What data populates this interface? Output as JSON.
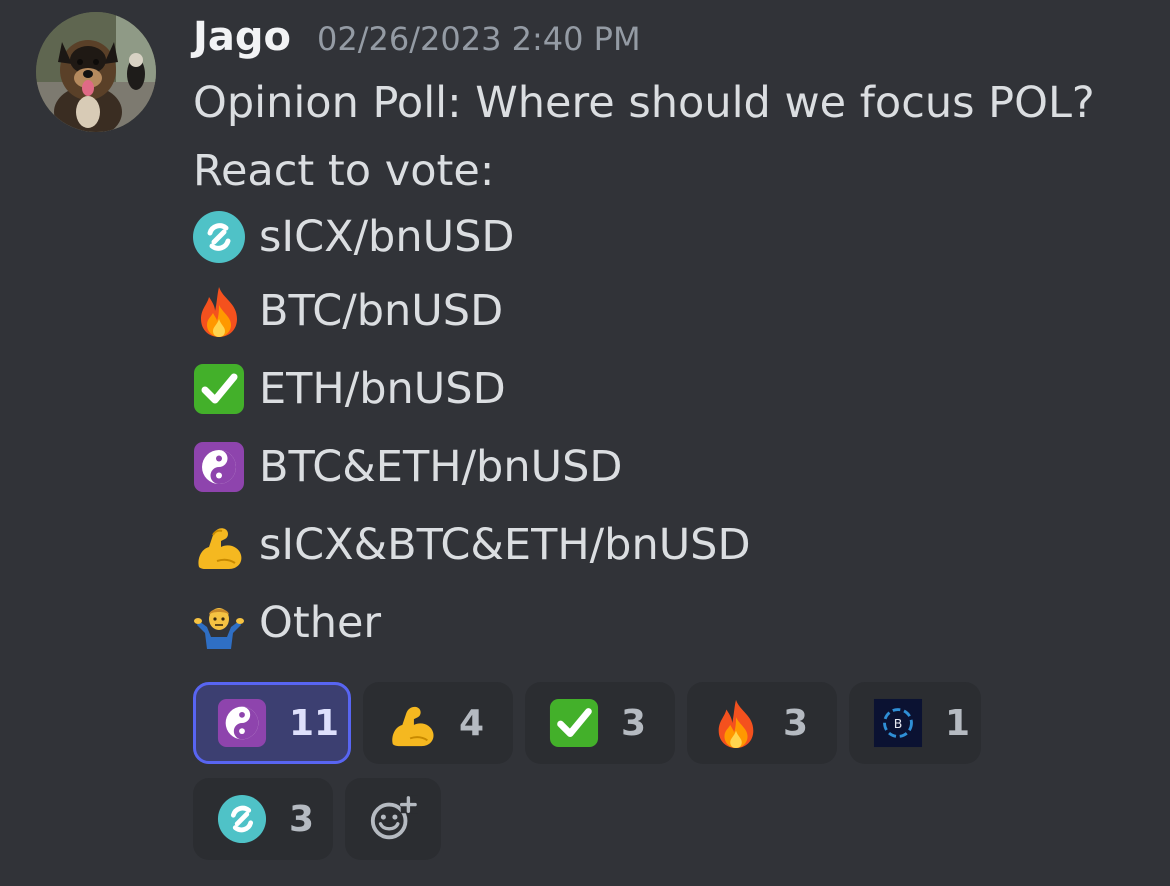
{
  "message": {
    "username": "Jago",
    "timestamp": "02/26/2023 2:40 PM",
    "line1": "Opinion Poll: Where should we focus POL?",
    "line2": "React to vote:",
    "options": [
      {
        "icon": "icx-icon",
        "label": "sICX/bnUSD"
      },
      {
        "icon": "fire-icon",
        "label": "BTC/bnUSD"
      },
      {
        "icon": "check-mark-icon",
        "label": "ETH/bnUSD"
      },
      {
        "icon": "yin-yang-icon",
        "label": "BTC&ETH/bnUSD"
      },
      {
        "icon": "flexed-biceps-icon",
        "label": "sICX&BTC&ETH/bnUSD"
      },
      {
        "icon": "shrug-icon",
        "label": "Other"
      }
    ]
  },
  "reactions": [
    {
      "icon": "yin-yang-icon",
      "count": "11",
      "active": true
    },
    {
      "icon": "flexed-biceps-icon",
      "count": "4",
      "active": false
    },
    {
      "icon": "check-mark-icon",
      "count": "3",
      "active": false
    },
    {
      "icon": "fire-icon",
      "count": "3",
      "active": false
    },
    {
      "icon": "balanced-logo-icon",
      "logo_text": "B",
      "count": "1",
      "active": false
    },
    {
      "icon": "icx-icon",
      "count": "3",
      "active": false
    },
    {
      "icon": "add-reaction-icon",
      "count": "",
      "active": false
    }
  ],
  "colors": {
    "background": "#313338",
    "reaction_bg": "#2b2d31",
    "reaction_active_bg": "#3c3f71",
    "reaction_active_border": "#5865f2",
    "text": "#dbdee1",
    "muted": "#949ba4"
  }
}
